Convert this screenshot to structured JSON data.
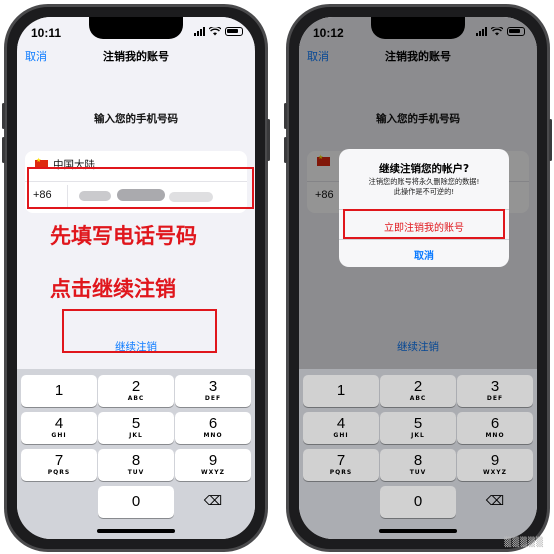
{
  "left_phone": {
    "time": "10:11",
    "nav": {
      "cancel": "取消",
      "title": "注销我的账号"
    },
    "prompt": "输入您的手机号码",
    "region": "中国大陆",
    "country_code": "+86",
    "continue": "继续注销"
  },
  "right_phone": {
    "time": "10:12",
    "nav": {
      "cancel": "取消",
      "title": "注销我的账号"
    },
    "prompt": "输入您的手机号码",
    "country_code": "+86",
    "continue": "继续注销",
    "alert": {
      "title": "继续注销您的帐户?",
      "message_line1": "注销您的账号将永久删除您的数据!",
      "message_line2": "此操作是不可逆的!",
      "destructive": "立即注销我的账号",
      "cancel": "取消"
    }
  },
  "keypad": [
    {
      "num": "1",
      "letters": ""
    },
    {
      "num": "2",
      "letters": "ABC"
    },
    {
      "num": "3",
      "letters": "DEF"
    },
    {
      "num": "4",
      "letters": "GHI"
    },
    {
      "num": "5",
      "letters": "JKL"
    },
    {
      "num": "6",
      "letters": "MNO"
    },
    {
      "num": "7",
      "letters": "PQRS"
    },
    {
      "num": "8",
      "letters": "TUV"
    },
    {
      "num": "9",
      "letters": "WXYZ"
    },
    {
      "num": "0",
      "letters": ""
    }
  ],
  "annotations": {
    "step1": "先填写电话号码",
    "step2": "点击继续注销"
  },
  "colors": {
    "accent": "#0a7aff",
    "annotation": "#e0161c",
    "destructive": "#e0161c"
  },
  "icons": {
    "delete_key": "backspace-icon",
    "flag": "china-flag-icon"
  }
}
